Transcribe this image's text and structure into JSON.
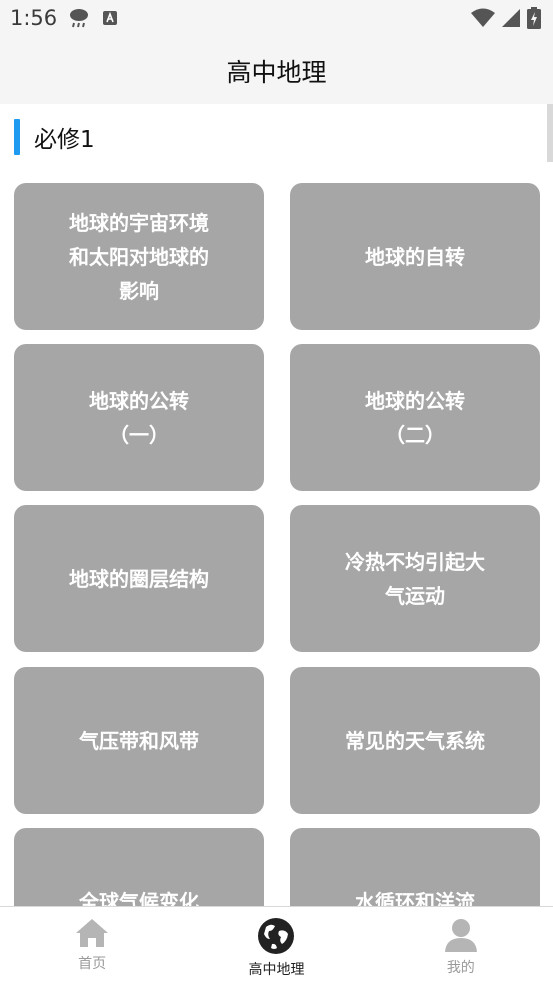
{
  "status_bar": {
    "time": "1:56",
    "left_icons": [
      "cloud-rain-icon",
      "letter-a-icon"
    ],
    "right_icons": [
      "wifi-icon",
      "signal-icon",
      "battery-charging-icon"
    ]
  },
  "header": {
    "title": "高中地理"
  },
  "section": {
    "title": "必修1",
    "accent_color": "#1e9bf0"
  },
  "topics": [
    {
      "label": "地球的宇宙环境\n和太阳对地球的\n影响"
    },
    {
      "label": "地球的自转"
    },
    {
      "label": "地球的公转\n（一）"
    },
    {
      "label": "地球的公转\n（二）"
    },
    {
      "label": "地球的圈层结构"
    },
    {
      "label": "冷热不均引起大\n气运动"
    },
    {
      "label": "气压带和风带"
    },
    {
      "label": "常见的天气系统"
    },
    {
      "label": "全球气候变化"
    },
    {
      "label": "水循环和洋流"
    }
  ],
  "colors": {
    "card_bg": "#a6a6a6",
    "active_nav": "#222222",
    "inactive_nav": "#9a9a9a"
  },
  "bottom_nav": [
    {
      "label": "首页",
      "icon": "home-icon",
      "active": false
    },
    {
      "label": "高中地理",
      "icon": "globe-icon",
      "active": true
    },
    {
      "label": "我的",
      "icon": "user-icon",
      "active": false
    }
  ]
}
